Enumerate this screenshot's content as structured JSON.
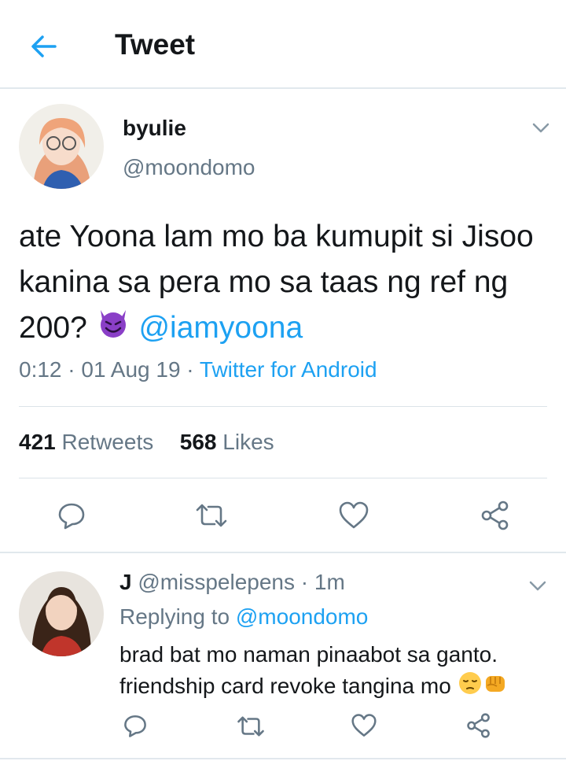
{
  "header": {
    "title": "Tweet"
  },
  "tweet": {
    "name": "byulie",
    "handle": "@moondomo",
    "text_before_mention": "ate Yoona lam mo ba kumupit si Jisoo kanina sa pera mo sa taas ng ref ng 200?",
    "mention": "@iamyoona",
    "time": "0:12",
    "date": "01 Aug 19",
    "source": "Twitter for Android",
    "retweets_count": "421",
    "retweets_label": "Retweets",
    "likes_count": "568",
    "likes_label": "Likes"
  },
  "reply": {
    "name": "J",
    "handle": "@misspelepens",
    "age": "1m",
    "replying_to_label": "Replying to",
    "replying_to_handle": "@moondomo",
    "line1": "brad bat mo naman pinaabot sa ganto.",
    "line2": "friendship card revoke tangina mo"
  },
  "icons": {
    "back": "arrow-left-icon",
    "caret": "chevron-down-icon",
    "reply": "reply-icon",
    "retweet": "retweet-icon",
    "like": "heart-icon",
    "share": "share-icon",
    "emoji1": "smiling-devil-emoji",
    "emoji2": "pensive-face-emoji",
    "emoji3": "oncoming-fist-emoji"
  },
  "colors": {
    "accent": "#1da1f2",
    "secondary_text": "#657786",
    "divider": "#e1e8ed"
  }
}
